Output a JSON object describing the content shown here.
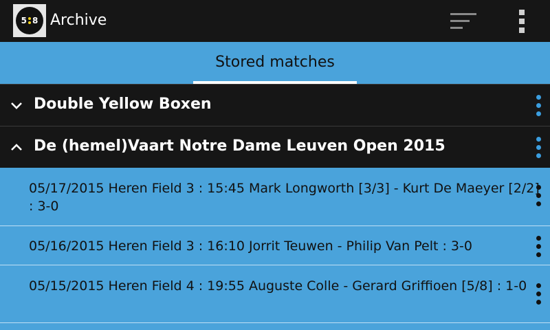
{
  "appbar": {
    "title": "Archive",
    "logo_left": "5",
    "logo_right": "8",
    "sort_icon": "sort-icon",
    "menu_icon": "more-vert-icon"
  },
  "tabs": [
    {
      "label": "Stored matches",
      "selected": true
    }
  ],
  "groups": [
    {
      "label": "Double Yellow Boxen",
      "expanded": false
    },
    {
      "label": "De (hemel)Vaart Notre Dame Leuven Open 2015",
      "expanded": true,
      "matches": [
        {
          "text": "05/17/2015 Heren Field 3 : 15:45 Mark Longworth [3/3] - Kurt De Maeyer [2/2] : 3-0"
        },
        {
          "text": "05/16/2015 Heren Field 3 : 16:10 Jorrit Teuwen - Philip Van Pelt : 3-0"
        },
        {
          "text": "05/15/2015 Heren Field 4 : 19:55 Auguste Colle - Gerard Griffioen [5/8] : 1-0"
        }
      ]
    }
  ],
  "colors": {
    "appbar": "#161616",
    "accent": "#4aa3db",
    "kebab_blue": "#3b9ee0",
    "logo_dots": "#f2d21b"
  }
}
